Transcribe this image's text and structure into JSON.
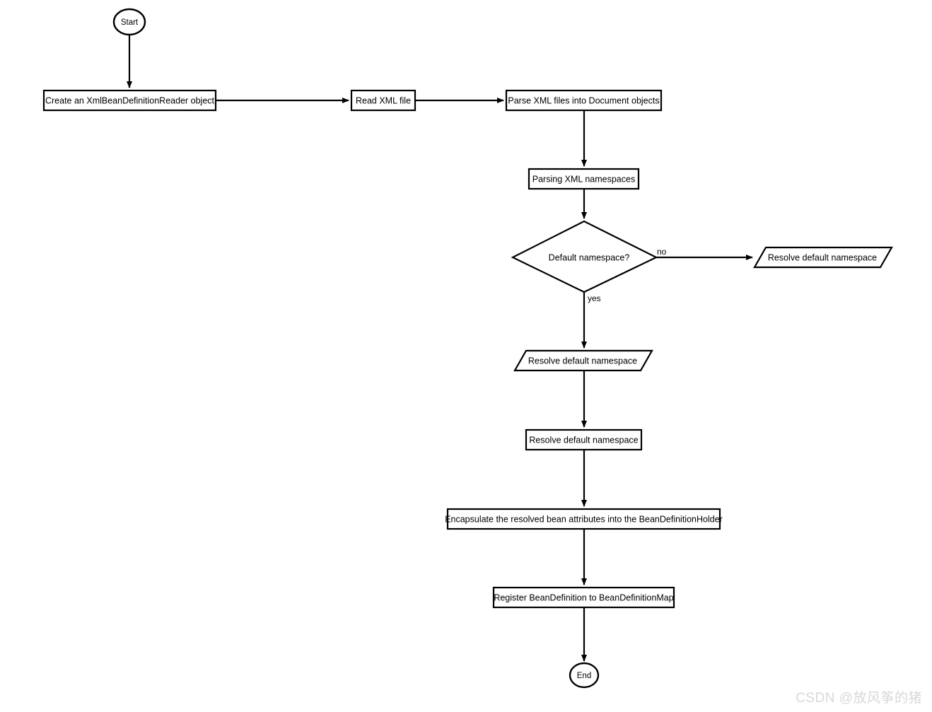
{
  "diagram": {
    "title": "Spring XML BeanDefinition parsing flow",
    "background_color": "#ffffff",
    "stroke_color": "#000000",
    "fill_color": "#ffffff",
    "nodes": [
      {
        "id": "start",
        "label": "Start",
        "shape": "ellipse"
      },
      {
        "id": "create_reader",
        "label": "Create an XmlBeanDefinitionReader object",
        "shape": "rect"
      },
      {
        "id": "read_xml",
        "label": "Read XML file",
        "shape": "rect"
      },
      {
        "id": "parse_document",
        "label": "Parse XML files into Document objects",
        "shape": "rect"
      },
      {
        "id": "parse_namespaces",
        "label": "Parsing XML namespaces",
        "shape": "rect"
      },
      {
        "id": "decision",
        "label": "Default namespace?",
        "shape": "diamond"
      },
      {
        "id": "resolve_no",
        "label": "Resolve default namespace",
        "shape": "parallelogram"
      },
      {
        "id": "resolve_yes",
        "label": "Resolve default namespace",
        "shape": "parallelogram"
      },
      {
        "id": "resolve_rect",
        "label": "Resolve default namespace",
        "shape": "rect"
      },
      {
        "id": "encapsulate",
        "label": "Encapsulate the resolved bean attributes into the BeanDefinitionHolder",
        "shape": "rect"
      },
      {
        "id": "register",
        "label": "Register BeanDefinition to BeanDefinitionMap",
        "shape": "rect"
      },
      {
        "id": "end",
        "label": "End",
        "shape": "ellipse"
      }
    ],
    "edges": [
      {
        "from": "start",
        "to": "create_reader",
        "label": ""
      },
      {
        "from": "create_reader",
        "to": "read_xml",
        "label": ""
      },
      {
        "from": "read_xml",
        "to": "parse_document",
        "label": ""
      },
      {
        "from": "parse_document",
        "to": "parse_namespaces",
        "label": ""
      },
      {
        "from": "parse_namespaces",
        "to": "decision",
        "label": ""
      },
      {
        "from": "decision",
        "to": "resolve_no",
        "label": "no"
      },
      {
        "from": "decision",
        "to": "resolve_yes",
        "label": "yes"
      },
      {
        "from": "resolve_yes",
        "to": "resolve_rect",
        "label": ""
      },
      {
        "from": "resolve_rect",
        "to": "encapsulate",
        "label": ""
      },
      {
        "from": "encapsulate",
        "to": "register",
        "label": ""
      },
      {
        "from": "register",
        "to": "end",
        "label": ""
      }
    ],
    "edge_labels": {
      "no": "no",
      "yes": "yes"
    }
  },
  "watermark": {
    "text": "CSDN @放风筝的猪",
    "color": "#d8d8d8"
  }
}
